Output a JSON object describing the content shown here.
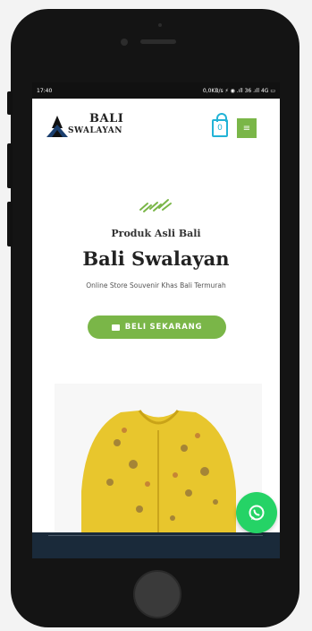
{
  "statusbar": {
    "time": "17:40",
    "right": "0,0KB/s ⚡ ◉ .ıll 36 .ıll 4G ▭"
  },
  "header": {
    "logo_top": "BALI",
    "logo_bottom": "SWALAYAN",
    "cart_count": "0"
  },
  "hero": {
    "subtitle": "Produk Asli Bali",
    "title": "Bali Swalayan",
    "tagline": "Online Store Souvenir Khas Bali Termurah",
    "button_label": "BELI SEKARANG"
  },
  "colors": {
    "accent_green": "#7ab648",
    "cart_blue": "#22b3d6",
    "whatsapp_green": "#25d366",
    "dark_band": "#1a2a3a"
  },
  "icons": [
    "menu-icon",
    "cart-icon",
    "leaf-icon",
    "whatsapp-icon"
  ]
}
